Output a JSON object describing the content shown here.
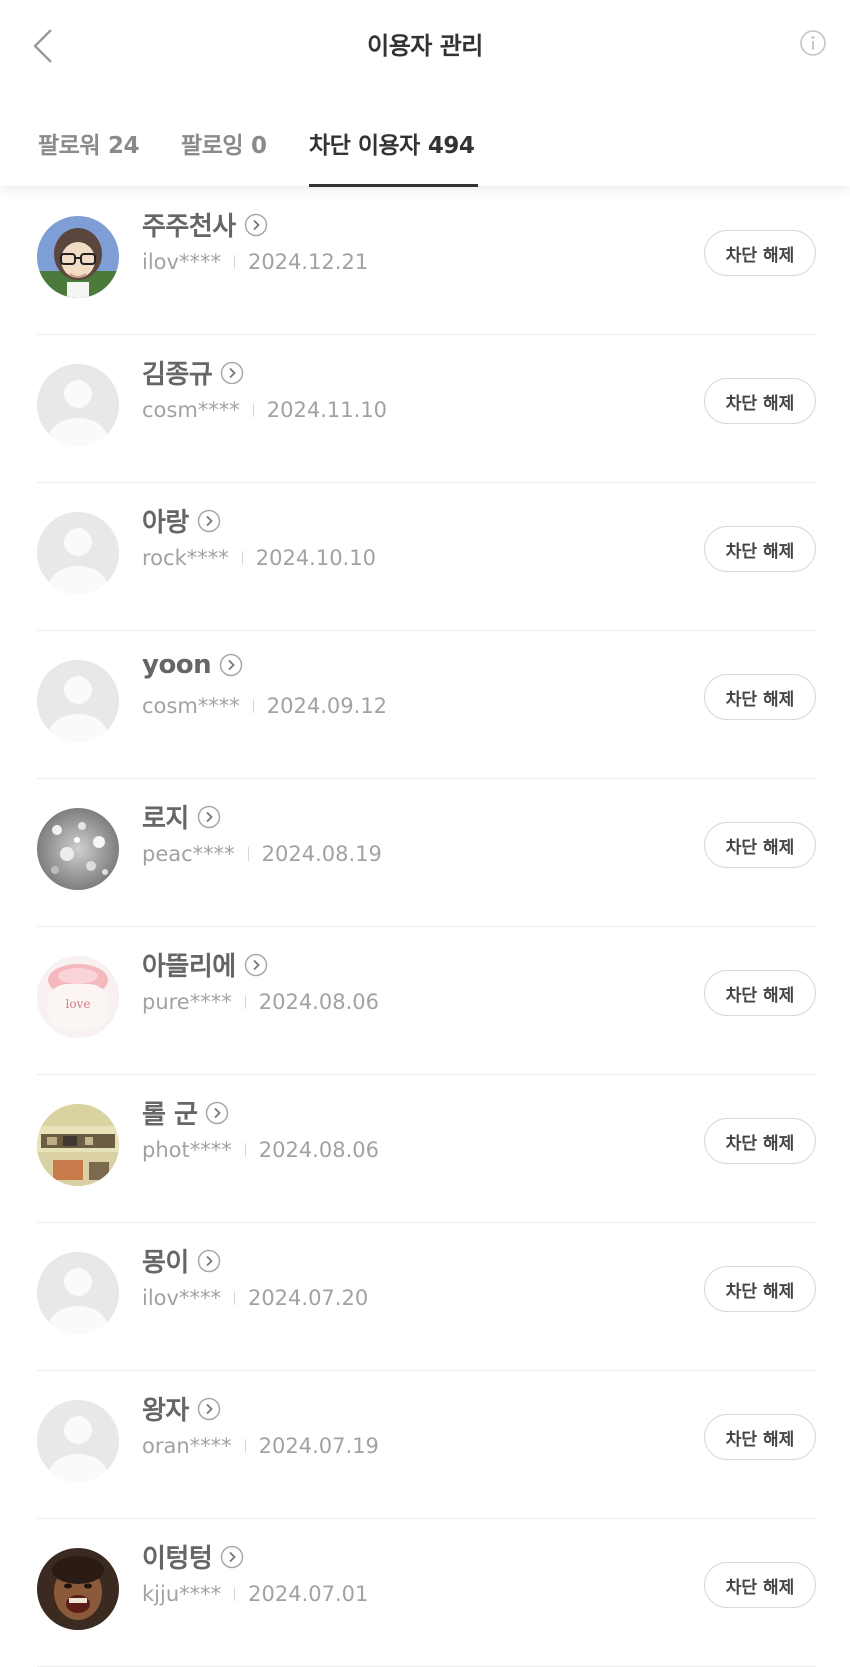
{
  "header": {
    "title": "이용자 관리"
  },
  "tabs": [
    {
      "label": "팔로워",
      "count": "24",
      "active": false
    },
    {
      "label": "팔로잉",
      "count": "0",
      "active": false
    },
    {
      "label": "차단 이용자",
      "count": "494",
      "active": true
    }
  ],
  "action_label": "차단 해제",
  "users": [
    {
      "name": "주주천사",
      "id": "ilov****",
      "date": "2024.12.21",
      "avatar": "custom-anime"
    },
    {
      "name": "김종규",
      "id": "cosm****",
      "date": "2024.11.10",
      "avatar": "default"
    },
    {
      "name": "아랑",
      "id": "rock****",
      "date": "2024.10.10",
      "avatar": "default"
    },
    {
      "name": "yoon",
      "id": "cosm****",
      "date": "2024.09.12",
      "avatar": "default"
    },
    {
      "name": "로지",
      "id": "peac****",
      "date": "2024.08.19",
      "avatar": "custom-glitter"
    },
    {
      "name": "아뜰리에",
      "id": "pure****",
      "date": "2024.08.06",
      "avatar": "custom-love"
    },
    {
      "name": "롤 군",
      "id": "phot****",
      "date": "2024.08.06",
      "avatar": "custom-room"
    },
    {
      "name": "몽이",
      "id": "ilov****",
      "date": "2024.07.20",
      "avatar": "default"
    },
    {
      "name": "왕자",
      "id": "oran****",
      "date": "2024.07.19",
      "avatar": "default"
    },
    {
      "name": "이텅텅",
      "id": "kjju****",
      "date": "2024.07.01",
      "avatar": "custom-face"
    }
  ],
  "avatar_love_text": "love"
}
